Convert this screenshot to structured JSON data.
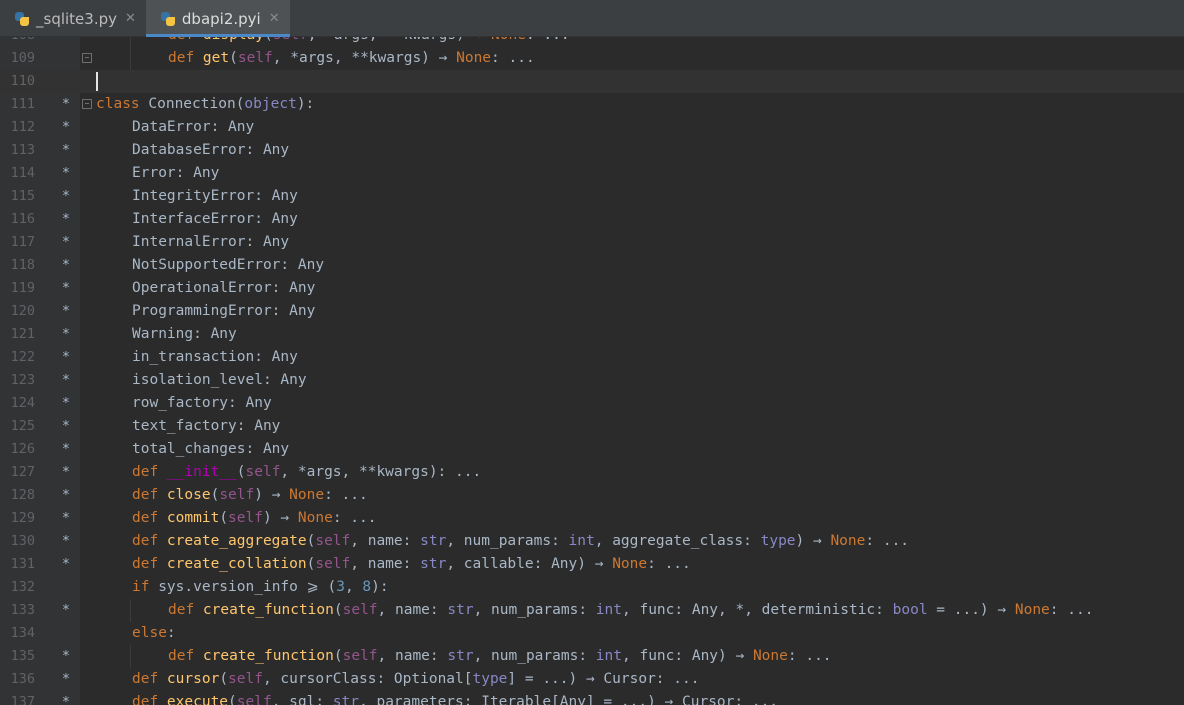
{
  "tabs": [
    {
      "label": "_sqlite3.py",
      "active": false
    },
    {
      "label": "dbapi2.pyi",
      "active": true
    }
  ],
  "lines": [
    {
      "n": "108",
      "mark": "",
      "indent": 2,
      "fold": false,
      "tokens": [
        [
          "kw",
          "def "
        ],
        [
          "fn",
          "display"
        ],
        [
          "pl",
          "("
        ],
        [
          "self",
          "self"
        ],
        [
          "pl",
          ", *args, **kwargs) → "
        ],
        [
          "kw",
          "None"
        ],
        [
          "pl",
          ": ..."
        ]
      ]
    },
    {
      "n": "109",
      "mark": "",
      "indent": 2,
      "fold": true,
      "tokens": [
        [
          "kw",
          "def "
        ],
        [
          "fn",
          "get"
        ],
        [
          "pl",
          "("
        ],
        [
          "self",
          "self"
        ],
        [
          "pl",
          ", *args, **kwargs) → "
        ],
        [
          "kw",
          "None"
        ],
        [
          "pl",
          ": ..."
        ]
      ]
    },
    {
      "n": "110",
      "mark": "",
      "indent": 0,
      "fold": false,
      "current": true,
      "caret": true,
      "tokens": []
    },
    {
      "n": "111",
      "mark": "*",
      "indent": 0,
      "fold": true,
      "tokens": [
        [
          "kw",
          "class "
        ],
        [
          "pl",
          "Connection("
        ],
        [
          "bi",
          "object"
        ],
        [
          "pl",
          "):"
        ]
      ]
    },
    {
      "n": "112",
      "mark": "*",
      "indent": 1,
      "tokens": [
        [
          "pl",
          "DataError: Any"
        ]
      ]
    },
    {
      "n": "113",
      "mark": "*",
      "indent": 1,
      "tokens": [
        [
          "pl",
          "DatabaseError: Any"
        ]
      ]
    },
    {
      "n": "114",
      "mark": "*",
      "indent": 1,
      "tokens": [
        [
          "pl",
          "Error: Any"
        ]
      ]
    },
    {
      "n": "115",
      "mark": "*",
      "indent": 1,
      "tokens": [
        [
          "pl",
          "IntegrityError: Any"
        ]
      ]
    },
    {
      "n": "116",
      "mark": "*",
      "indent": 1,
      "tokens": [
        [
          "pl",
          "InterfaceError: Any"
        ]
      ]
    },
    {
      "n": "117",
      "mark": "*",
      "indent": 1,
      "tokens": [
        [
          "pl",
          "InternalError: Any"
        ]
      ]
    },
    {
      "n": "118",
      "mark": "*",
      "indent": 1,
      "tokens": [
        [
          "pl",
          "NotSupportedError: Any"
        ]
      ]
    },
    {
      "n": "119",
      "mark": "*",
      "indent": 1,
      "tokens": [
        [
          "pl",
          "OperationalError: Any"
        ]
      ]
    },
    {
      "n": "120",
      "mark": "*",
      "indent": 1,
      "tokens": [
        [
          "pl",
          "ProgrammingError: Any"
        ]
      ]
    },
    {
      "n": "121",
      "mark": "*",
      "indent": 1,
      "tokens": [
        [
          "pl",
          "Warning: Any"
        ]
      ]
    },
    {
      "n": "122",
      "mark": "*",
      "indent": 1,
      "tokens": [
        [
          "pl",
          "in_transaction: Any"
        ]
      ]
    },
    {
      "n": "123",
      "mark": "*",
      "indent": 1,
      "tokens": [
        [
          "pl",
          "isolation_level: Any"
        ]
      ]
    },
    {
      "n": "124",
      "mark": "*",
      "indent": 1,
      "tokens": [
        [
          "pl",
          "row_factory: Any"
        ]
      ]
    },
    {
      "n": "125",
      "mark": "*",
      "indent": 1,
      "tokens": [
        [
          "pl",
          "text_factory: Any"
        ]
      ]
    },
    {
      "n": "126",
      "mark": "*",
      "indent": 1,
      "tokens": [
        [
          "pl",
          "total_changes: Any"
        ]
      ]
    },
    {
      "n": "127",
      "mark": "*",
      "indent": 1,
      "tokens": [
        [
          "kw",
          "def "
        ],
        [
          "magic",
          "__init__"
        ],
        [
          "pl",
          "("
        ],
        [
          "self",
          "self"
        ],
        [
          "pl",
          ", *args, **kwargs): ..."
        ]
      ]
    },
    {
      "n": "128",
      "mark": "*",
      "indent": 1,
      "tokens": [
        [
          "kw",
          "def "
        ],
        [
          "fn",
          "close"
        ],
        [
          "pl",
          "("
        ],
        [
          "self",
          "self"
        ],
        [
          "pl",
          ") → "
        ],
        [
          "kw",
          "None"
        ],
        [
          "pl",
          ": ..."
        ]
      ]
    },
    {
      "n": "129",
      "mark": "*",
      "indent": 1,
      "tokens": [
        [
          "kw",
          "def "
        ],
        [
          "fn",
          "commit"
        ],
        [
          "pl",
          "("
        ],
        [
          "self",
          "self"
        ],
        [
          "pl",
          ") → "
        ],
        [
          "kw",
          "None"
        ],
        [
          "pl",
          ": ..."
        ]
      ]
    },
    {
      "n": "130",
      "mark": "*",
      "indent": 1,
      "tokens": [
        [
          "kw",
          "def "
        ],
        [
          "fn",
          "create_aggregate"
        ],
        [
          "pl",
          "("
        ],
        [
          "self",
          "self"
        ],
        [
          "pl",
          ", name: "
        ],
        [
          "bi",
          "str"
        ],
        [
          "pl",
          ", num_params: "
        ],
        [
          "bi",
          "int"
        ],
        [
          "pl",
          ", aggregate_class: "
        ],
        [
          "bi",
          "type"
        ],
        [
          "pl",
          ") → "
        ],
        [
          "kw",
          "None"
        ],
        [
          "pl",
          ": ..."
        ]
      ]
    },
    {
      "n": "131",
      "mark": "*",
      "indent": 1,
      "tokens": [
        [
          "kw",
          "def "
        ],
        [
          "fn",
          "create_collation"
        ],
        [
          "pl",
          "("
        ],
        [
          "self",
          "self"
        ],
        [
          "pl",
          ", name: "
        ],
        [
          "bi",
          "str"
        ],
        [
          "pl",
          ", callable: Any) → "
        ],
        [
          "kw",
          "None"
        ],
        [
          "pl",
          ": ..."
        ]
      ]
    },
    {
      "n": "132",
      "mark": "",
      "indent": 1,
      "tokens": [
        [
          "kw",
          "if "
        ],
        [
          "pl",
          "sys.version_info ⩾ ("
        ],
        [
          "num",
          "3"
        ],
        [
          "pl",
          ", "
        ],
        [
          "num",
          "8"
        ],
        [
          "pl",
          "):"
        ]
      ]
    },
    {
      "n": "133",
      "mark": "*",
      "indent": 2,
      "tokens": [
        [
          "kw",
          "def "
        ],
        [
          "fn",
          "create_function"
        ],
        [
          "pl",
          "("
        ],
        [
          "self",
          "self"
        ],
        [
          "pl",
          ", name: "
        ],
        [
          "bi",
          "str"
        ],
        [
          "pl",
          ", num_params: "
        ],
        [
          "bi",
          "int"
        ],
        [
          "pl",
          ", func: Any, *, deterministic: "
        ],
        [
          "bi",
          "bool"
        ],
        [
          "pl",
          " = ...) → "
        ],
        [
          "kw",
          "None"
        ],
        [
          "pl",
          ": ..."
        ]
      ]
    },
    {
      "n": "134",
      "mark": "",
      "indent": 1,
      "tokens": [
        [
          "kw",
          "else"
        ],
        [
          "pl",
          ":"
        ]
      ]
    },
    {
      "n": "135",
      "mark": "*",
      "indent": 2,
      "tokens": [
        [
          "kw",
          "def "
        ],
        [
          "fn",
          "create_function"
        ],
        [
          "pl",
          "("
        ],
        [
          "self",
          "self"
        ],
        [
          "pl",
          ", name: "
        ],
        [
          "bi",
          "str"
        ],
        [
          "pl",
          ", num_params: "
        ],
        [
          "bi",
          "int"
        ],
        [
          "pl",
          ", func: Any) → "
        ],
        [
          "kw",
          "None"
        ],
        [
          "pl",
          ": ..."
        ]
      ]
    },
    {
      "n": "136",
      "mark": "*",
      "indent": 1,
      "tokens": [
        [
          "kw",
          "def "
        ],
        [
          "fn",
          "cursor"
        ],
        [
          "pl",
          "("
        ],
        [
          "self",
          "self"
        ],
        [
          "pl",
          ", cursorClass: Optional["
        ],
        [
          "bi",
          "type"
        ],
        [
          "pl",
          "] = ...) → Cursor: ..."
        ]
      ]
    },
    {
      "n": "137",
      "mark": "*",
      "indent": 1,
      "tokens": [
        [
          "kw",
          "def "
        ],
        [
          "fn",
          "execute"
        ],
        [
          "pl",
          "("
        ],
        [
          "self",
          "self"
        ],
        [
          "pl",
          ", sql: "
        ],
        [
          "bi",
          "str"
        ],
        [
          "pl",
          ", parameters: Iterable[Any] = ...) → Cursor: ..."
        ]
      ]
    }
  ]
}
